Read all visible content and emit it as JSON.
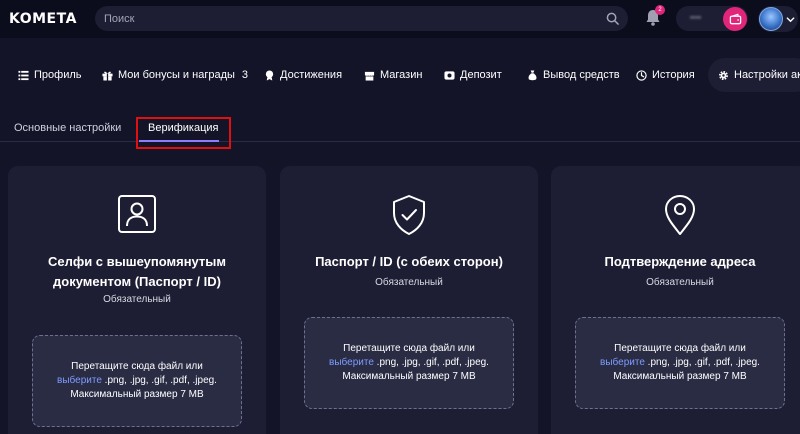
{
  "header": {
    "logo": "KOMETA",
    "search_placeholder": "Поиск",
    "notification_count": "2",
    "balance": "••••"
  },
  "nav": {
    "items": [
      {
        "label": "Профиль",
        "icon": "profile-icon"
      },
      {
        "label": "Мои бонусы и награды",
        "icon": "gift-icon",
        "count": "3"
      },
      {
        "label": "Достижения",
        "icon": "achievement-icon"
      },
      {
        "label": "Магазин",
        "icon": "shop-icon"
      },
      {
        "label": "Депозит",
        "icon": "deposit-icon"
      },
      {
        "label": "Вывод средств",
        "icon": "withdraw-icon"
      },
      {
        "label": "История",
        "icon": "history-icon"
      },
      {
        "label": "Настройки ак",
        "icon": "settings-icon"
      }
    ]
  },
  "subtabs": {
    "basic": "Основные настройки",
    "verification": "Верификация"
  },
  "cards": [
    {
      "title_line1": "Селфи с вышеупомянутым",
      "title_line2": "документом (Паспорт / ID)",
      "subtitle": "Обязательный",
      "icon": "selfie-id-icon"
    },
    {
      "title_line1": "Паспорт / ID (с обеих сторон)",
      "subtitle": "Обязательный",
      "icon": "shield-check-icon"
    },
    {
      "title_line1": "Подтверждение адреса",
      "subtitle": "Обязательный",
      "icon": "location-pin-icon"
    }
  ],
  "dropzone": {
    "line1": "Перетащите сюда файл или",
    "link": "выберите",
    "formats": " .png, .jpg, .gif, .pdf, .jpeg.",
    "max_size": "Максимальный размер 7 MB"
  },
  "colors": {
    "background": "#131427",
    "card": "#1d1e33",
    "accent_pink": "#e0257a",
    "accent_purple": "#8f7cff",
    "link": "#7e9bff",
    "highlight_red": "#e01010"
  }
}
